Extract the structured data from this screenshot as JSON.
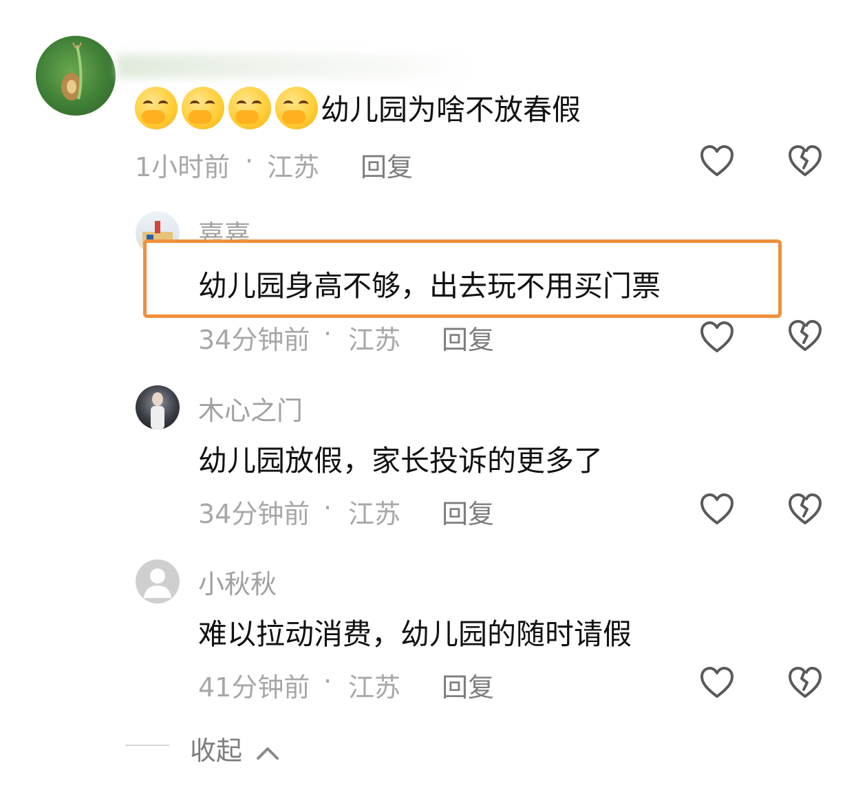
{
  "comments": [
    {
      "text": "幼儿园为啥不放春假",
      "time": "1小时前",
      "separator": "·",
      "location": "江苏",
      "reply_label": "回复"
    }
  ],
  "replies": [
    {
      "username": "嘉嘉",
      "text": "幼儿园身高不够，出去玩不用买门票",
      "time": "34分钟前",
      "separator": "·",
      "location": "江苏",
      "reply_label": "回复"
    },
    {
      "username": "木心之门",
      "text": "幼儿园放假，家长投诉的更多了",
      "time": "34分钟前",
      "separator": "·",
      "location": "江苏",
      "reply_label": "回复"
    },
    {
      "username": "小秋秋",
      "text": "难以拉动消费，幼儿园的随时请假",
      "time": "41分钟前",
      "separator": "·",
      "location": "江苏",
      "reply_label": "回复"
    }
  ],
  "footer": {
    "collapse_label": "收起"
  },
  "highlight_color": "#f0903c",
  "icons": {
    "like": "heart-outline-icon",
    "dislike": "broken-heart-icon",
    "collapse": "chevron-up-icon",
    "emoji": "face-with-hand-over-mouth-icon"
  }
}
